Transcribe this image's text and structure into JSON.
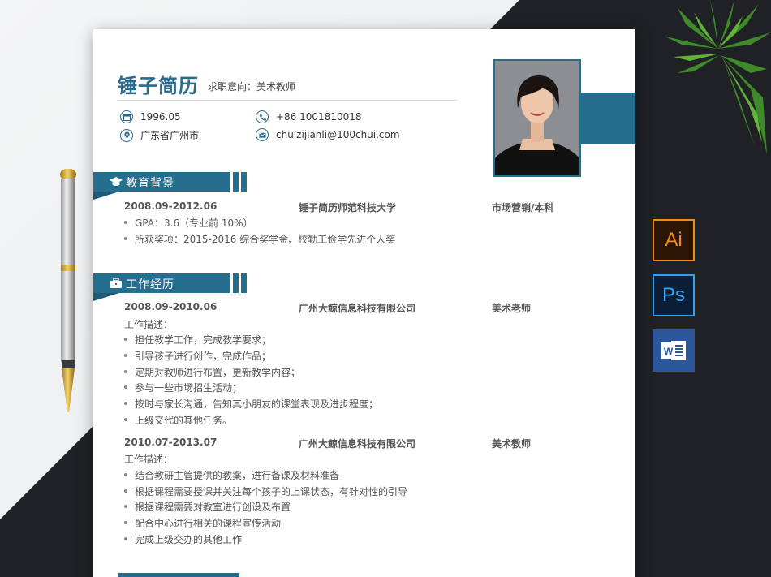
{
  "header": {
    "name": "锤子简历",
    "intent": "求职意向：美术教师"
  },
  "info": {
    "birth": "1996.05",
    "location": "广东省广州市",
    "phone": "+86 1001810018",
    "email": "chuizijianli@100chui.com"
  },
  "education": {
    "title": "教育背景",
    "period": "2008.09-2012.06",
    "school": "锤子简历师范科技大学",
    "major": "市场营销/本科",
    "items": [
      "GPA：3.6（专业前 10%）",
      "所获奖项：2015-2016 综合奖学金、校勤工俭学先进个人奖"
    ]
  },
  "work": {
    "title": "工作经历",
    "jobs": [
      {
        "period": "2008.09-2010.06",
        "company": "广州大鲸信息科技有限公司",
        "role": "美术老师",
        "desc_label": "工作描述：",
        "items": [
          "担任教学工作，完成教学要求；",
          "引导孩子进行创作，完成作品；",
          "定期对教师进行布置，更新教学内容；",
          "参与一些市场招生活动；",
          "按时与家长沟通，告知其小朋友的课堂表现及进步程度；",
          "上级交代的其他任务。"
        ]
      },
      {
        "period": "2010.07-2013.07",
        "company": "广州大鲸信息科技有限公司",
        "role": "美术教师",
        "desc_label": "工作描述：",
        "items": [
          "结合教研主管提供的教案，进行备课及材料准备",
          "根据课程需要授课并关注每个孩子的上课状态，有针对性的引导",
          "根据课程需要对教室进行创设及布置",
          "配合中心进行相关的课程宣传活动",
          "完成上级交办的其他工作"
        ]
      }
    ]
  },
  "apps": {
    "ai": "Ai",
    "ps": "Ps",
    "word": "W"
  },
  "colors": {
    "accent": "#256e8d",
    "name": "#2a6a8c"
  }
}
